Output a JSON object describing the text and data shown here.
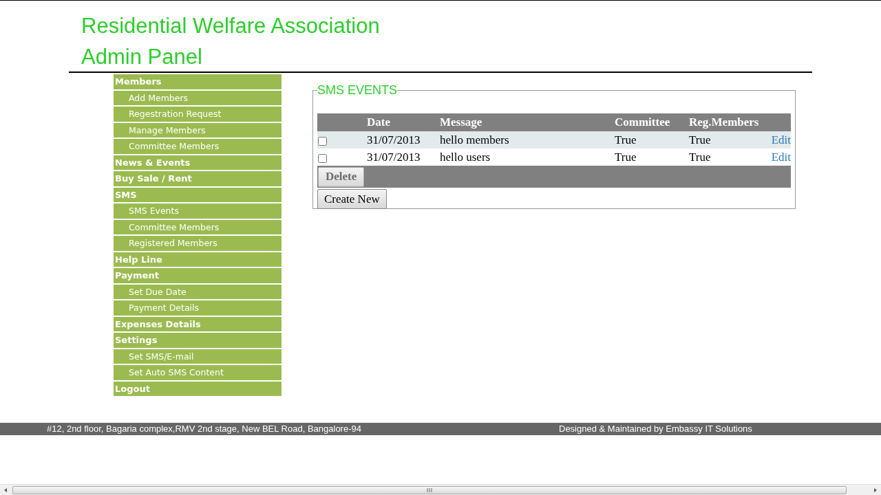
{
  "header": {
    "title": "Residential Welfare Association",
    "subtitle": "Admin Panel"
  },
  "sidebar": {
    "items": [
      {
        "label": "Members",
        "kind": "header"
      },
      {
        "label": "Add Members",
        "kind": "sub"
      },
      {
        "label": "Regestration Request",
        "kind": "sub"
      },
      {
        "label": "Manage Members",
        "kind": "sub"
      },
      {
        "label": "Committee Members",
        "kind": "sub"
      },
      {
        "label": "News & Events",
        "kind": "header"
      },
      {
        "label": "Buy Sale / Rent",
        "kind": "header"
      },
      {
        "label": "SMS",
        "kind": "header"
      },
      {
        "label": "SMS Events",
        "kind": "sub"
      },
      {
        "label": "Committee Members",
        "kind": "sub"
      },
      {
        "label": "Registered Members",
        "kind": "sub"
      },
      {
        "label": "Help Line",
        "kind": "header"
      },
      {
        "label": "Payment",
        "kind": "header"
      },
      {
        "label": "Set Due Date",
        "kind": "sub"
      },
      {
        "label": "Payment Details",
        "kind": "sub"
      },
      {
        "label": "Expenses Details",
        "kind": "header"
      },
      {
        "label": "Settings",
        "kind": "header"
      },
      {
        "label": "Set SMS/E-mail",
        "kind": "sub"
      },
      {
        "label": "Set Auto SMS Content",
        "kind": "sub"
      },
      {
        "label": "Logout",
        "kind": "header"
      }
    ]
  },
  "panel": {
    "legend": "SMS EVENTS",
    "table": {
      "columns": [
        "Date",
        "Message",
        "Committee",
        "Reg.Members"
      ],
      "rows": [
        {
          "checked": false,
          "date": "31/07/2013",
          "message": "hello members",
          "committee": "True",
          "reg_members": "True",
          "action": "Edit"
        },
        {
          "checked": false,
          "date": "31/07/2013",
          "message": "hello users",
          "committee": "True",
          "reg_members": "True",
          "action": "Edit"
        }
      ]
    },
    "delete_button": {
      "label": "Delete",
      "disabled": true
    },
    "create_button": "Create New"
  },
  "footer": {
    "address": "#12, 2nd floor, Bagaria complex,RMV 2nd stage, New BEL Road, Bangalore-94",
    "credit": "Designed & Maintained by Embassy IT Solutions"
  }
}
